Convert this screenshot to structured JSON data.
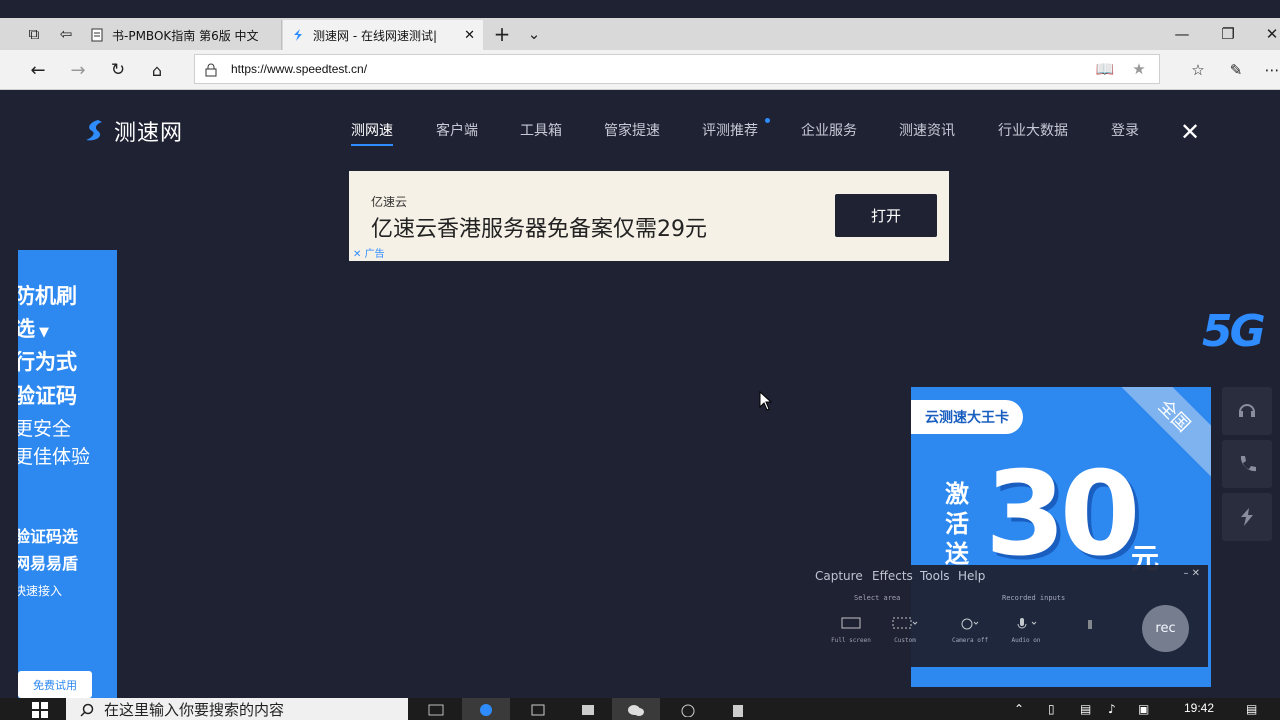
{
  "browser": {
    "tabs": [
      {
        "title": "书-PMBOK指南 第6版 中文"
      },
      {
        "title": "测速网 - 在线网速测试|"
      }
    ],
    "new_tab_label": "+",
    "url": "https://www.speedtest.cn/"
  },
  "site": {
    "logo_text": "测速网",
    "nav": [
      "测网速",
      "客户端",
      "工具箱",
      "管家提速",
      "评测推荐",
      "企业服务",
      "测速资讯",
      "行业大数据",
      "登录"
    ],
    "active_nav": "测网速"
  },
  "ad": {
    "brand": "亿速云",
    "headline": "亿速云香港服务器免备案仅需29元",
    "button": "打开",
    "label": "广告"
  },
  "left_banner": {
    "line1": "防机刷",
    "line2": "选",
    "line3": "行为式",
    "line4": "验证码",
    "line5": "更安全",
    "line6": "更佳体验",
    "line7": "验证码选",
    "line8": "网易易盾",
    "line9": "快速接入",
    "button": "免费试用"
  },
  "badge_5g": "5G",
  "promo": {
    "title": "云测速大王卡",
    "corner": "全国",
    "verb": "激活送",
    "amount": "30",
    "unit": "元"
  },
  "recorder": {
    "menu": [
      "Capture",
      "Effects",
      "Tools",
      "Help"
    ],
    "sections": [
      "Select area",
      "Recorded inputs"
    ],
    "options": [
      "Full screen",
      "Custom",
      "Camera off",
      "Audio on"
    ],
    "rec_label": "rec"
  },
  "taskbar": {
    "search_placeholder": "在这里输入你要搜索的内容",
    "time": "19:42"
  },
  "colors": {
    "page_bg": "#1f2233",
    "accent": "#2f8cff",
    "banner_blue": "#2d88f0"
  }
}
